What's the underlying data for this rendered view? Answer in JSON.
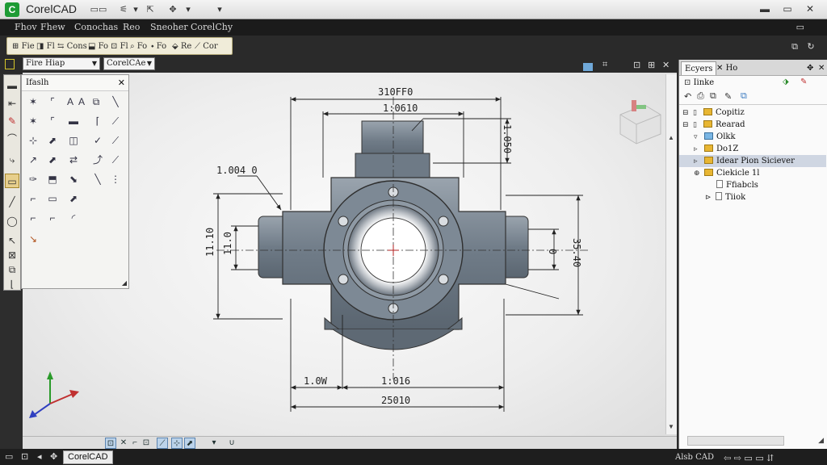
{
  "window": {
    "title": "CorelCAD",
    "minimize": "▬",
    "restore": "▭",
    "close": "✕"
  },
  "quick_access": [
    "▭▭",
    "⚟",
    "▾",
    "⇱",
    "✥",
    "▾",
    "▾"
  ],
  "menubar": {
    "items": [
      "Fhov",
      "Fhew",
      "Conochas",
      "Reo",
      "Sneoher",
      "CorelChy"
    ],
    "right_icon": "▭"
  },
  "toolbar": {
    "buttons": [
      "Fie",
      "Fl",
      "Cons",
      "Fo",
      "Fl",
      "Fo",
      "Fo",
      "Re",
      "Cor"
    ],
    "right_icons": [
      "⧉",
      "↻"
    ]
  },
  "layer_bar": {
    "combo1": "Fire Hiap",
    "combo2": "CorelCAe"
  },
  "draw_panel": {
    "title": "Ifaslh",
    "close": "✕",
    "icons": [
      "✶",
      "⌜",
      "A",
      "A",
      "⧉",
      "╲",
      "✶",
      "⌜",
      "▬",
      "⌈",
      "⟋",
      "⊹",
      "⬈",
      "◫",
      "✓",
      "⟋",
      "↗",
      "⬈",
      "⇄",
      "⤴",
      "⟋",
      "✑",
      "⬒",
      "⬊",
      "╲",
      "⋮",
      "⌐",
      "▭",
      "⬈",
      "⌐",
      "⌐",
      "◜",
      "↘"
    ]
  },
  "left_tools": [
    "▬",
    "⇤",
    "✎",
    "⌒",
    "⤷",
    "▭",
    "╱",
    "◯",
    "↖",
    "⊠",
    "⧉",
    "⌊"
  ],
  "drawing": {
    "dim_top_outer": "310FF0",
    "dim_top_inner": "1:0610",
    "dim_left_callout": "1.004 0",
    "dim_left_outer": "11.10",
    "dim_left_inner": "11.0",
    "dim_right_top": "1.050",
    "dim_right_inner": "0",
    "dim_right_outer": "35.40",
    "dim_bottom_left": "1.0W",
    "dim_bottom_right": "1:016",
    "dim_bottom_total": "25010"
  },
  "canvas_controls": [
    "⊡",
    "⊞",
    "✕"
  ],
  "right_panel": {
    "tabs": [
      "Ecyers",
      "Ho"
    ],
    "header": "Iinke",
    "tree": [
      {
        "exp": "⊟",
        "label": "Copitiz",
        "icon": "folder"
      },
      {
        "exp": "⊟",
        "label": "Rearad",
        "icon": "folder"
      },
      {
        "exp": "▿",
        "label": "Olkk",
        "icon": "folder-blue"
      },
      {
        "exp": "▹",
        "label": "Do1Z",
        "icon": "folder"
      },
      {
        "exp": "▹",
        "label": "Idear Pion Siciever",
        "icon": "folder"
      },
      {
        "exp": "⊕",
        "label": "Ciekicle 1l",
        "icon": "folder"
      },
      {
        "exp": "",
        "label": "Ffiabcls",
        "icon": "doc"
      },
      {
        "exp": "⊳",
        "label": "Tiiok",
        "icon": "doc"
      }
    ]
  },
  "statusbar": {
    "left_icons": [
      "▭",
      "⊡",
      "◂",
      "✥"
    ],
    "app": "CorelCAD",
    "right_text": "Alsb CAD"
  },
  "colors": {
    "menubar_bg": "#1b1b1b",
    "toolbar_strip": "#f0ecd9",
    "canvas_bg": "#eeeeee",
    "part_fill": "#7b8794",
    "selection": "#cfd6e2"
  }
}
